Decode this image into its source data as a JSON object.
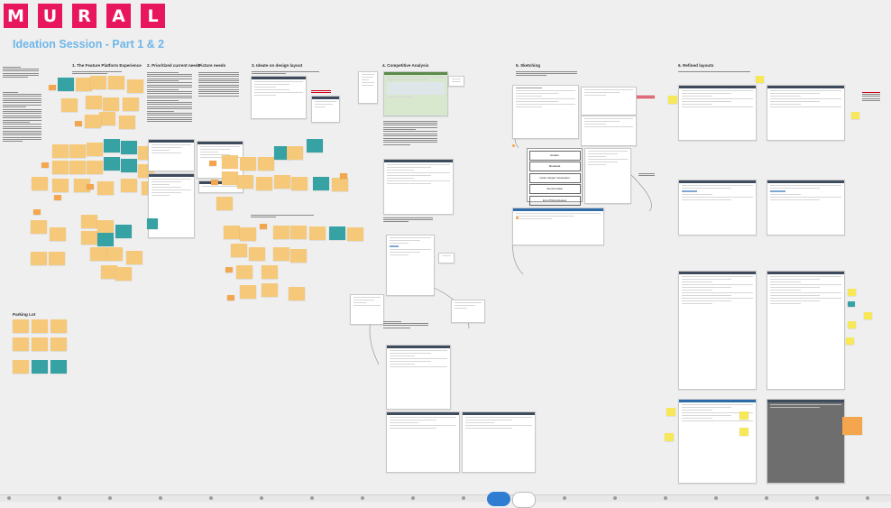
{
  "app": {
    "logo_letters": [
      "M",
      "U",
      "R",
      "A",
      "L"
    ],
    "logo_color": "#e8175d",
    "board_title": "Ideation Session - Part 1 & 2",
    "title_color": "#6fb6e8"
  },
  "frames": {
    "f1": "1. The Feature Platform Experience",
    "f2": "2. Prioritized current needs",
    "f3": "Picture needs",
    "f4": "3. Ideate on design layout",
    "f5": "4. Competitive Analysis",
    "f6": "5. Sketching",
    "f7": "6. Refined layouts",
    "parking": "Parking Lot"
  },
  "sketch_list": {
    "items": [
      "Header",
      "Metadata",
      "Code snippet / Exception",
      "Service Data",
      "Error/Ticking/Latest"
    ]
  },
  "colors": {
    "sticky_yellow": "#f6c97a",
    "sticky_teal": "#36a2a3",
    "sticky_orange": "#f3a64d",
    "sticky_lightyellow": "#f7e85a",
    "zoom_button": "#2f7dd1"
  }
}
